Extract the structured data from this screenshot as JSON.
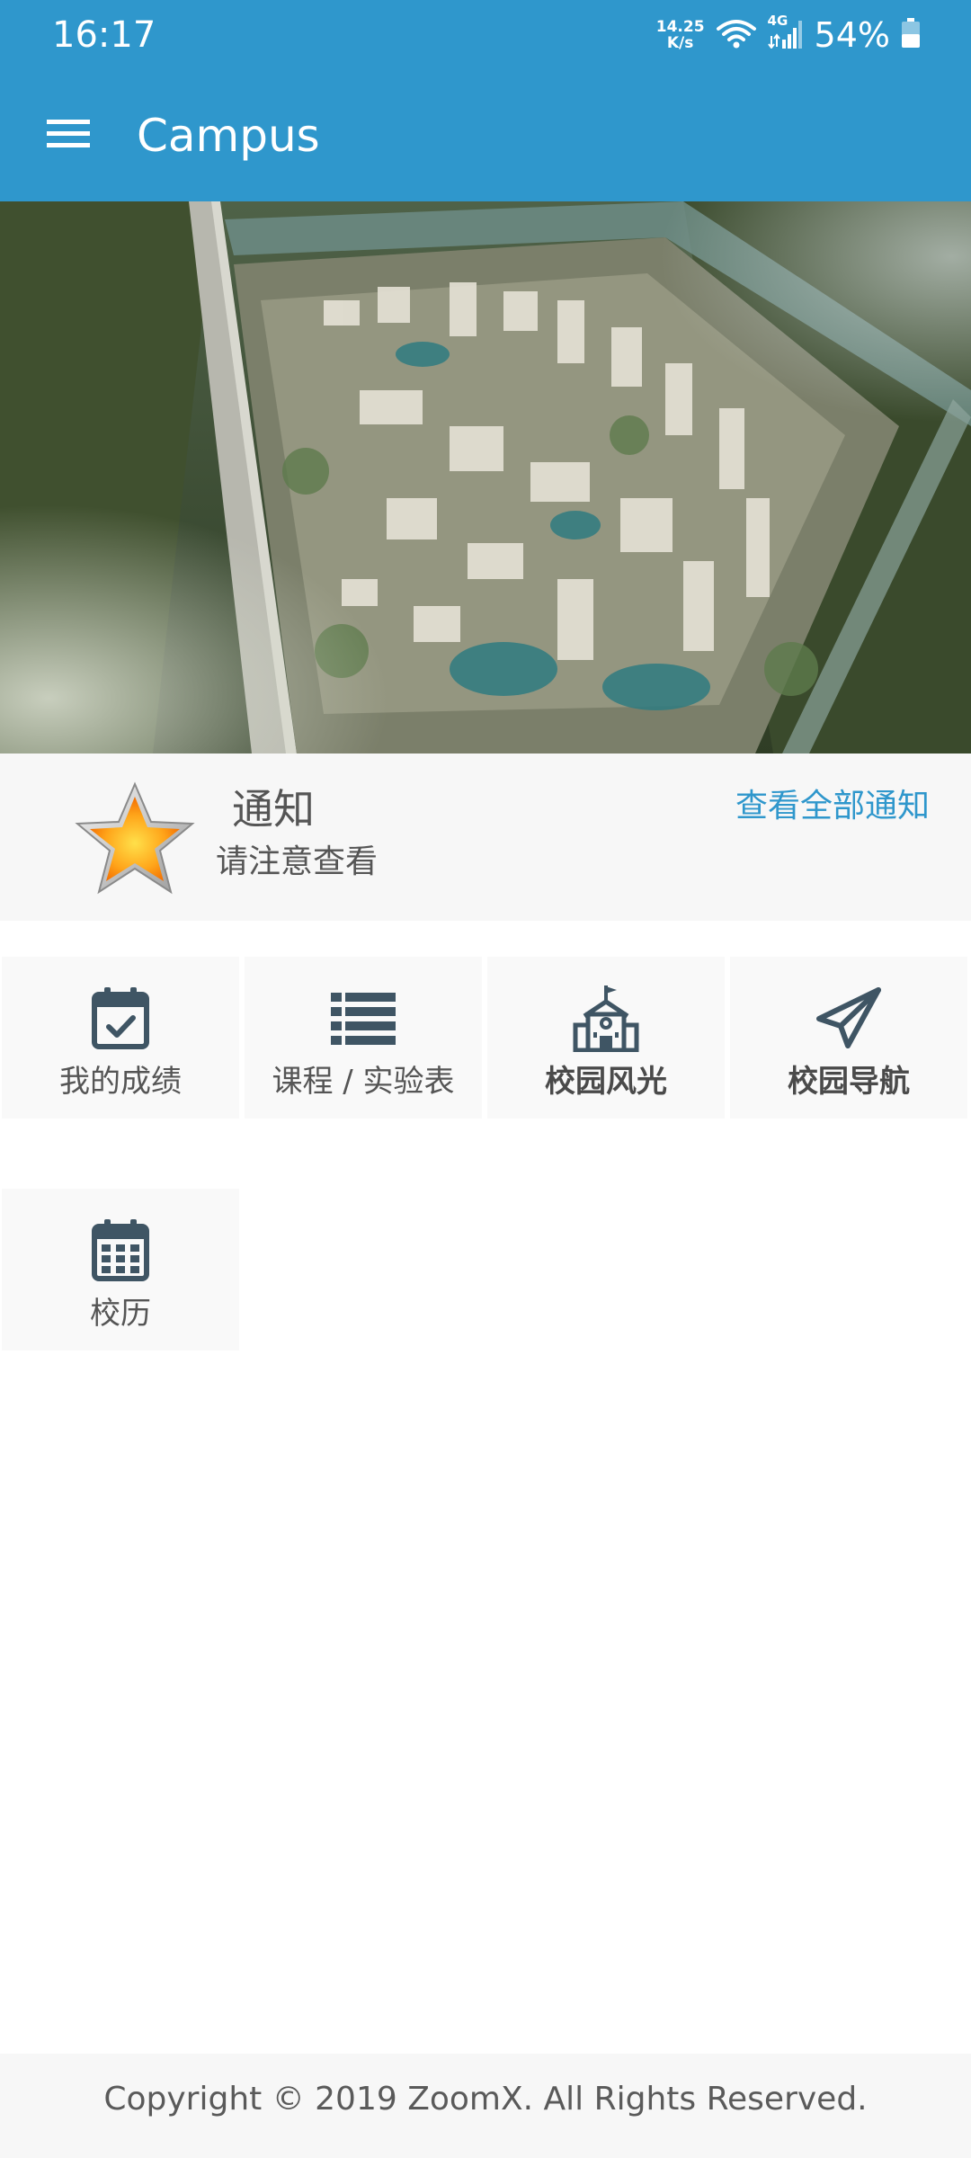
{
  "status_bar": {
    "time": "16:17",
    "net_speed_value": "14.25",
    "net_speed_unit": "K/s",
    "network": "4G",
    "battery": "54%",
    "icons": [
      "wifi-icon",
      "signal-icon",
      "battery-icon"
    ]
  },
  "app_bar": {
    "title": "Campus",
    "menu_icon": "menu-icon",
    "background": "#2f97cc"
  },
  "hero": {
    "image": "aerial campus illustration"
  },
  "notice": {
    "icon": "star-icon",
    "title": "通知",
    "subtitle": "请注意查看",
    "view_all": "查看全部通知",
    "link_color": "#2f97cc"
  },
  "features": {
    "items": [
      {
        "label": "我的成绩",
        "icon": "calendar-check-icon"
      },
      {
        "label": "课程 / 实验表",
        "icon": "list-icon"
      },
      {
        "label": "校园风光",
        "icon": "school-icon"
      },
      {
        "label": "校园导航",
        "icon": "paper-plane-icon"
      },
      {
        "label": "校历",
        "icon": "calendar-icon"
      }
    ]
  },
  "footer": {
    "copyright": "Copyright © 2019 ZoomX. All Rights Reserved."
  }
}
